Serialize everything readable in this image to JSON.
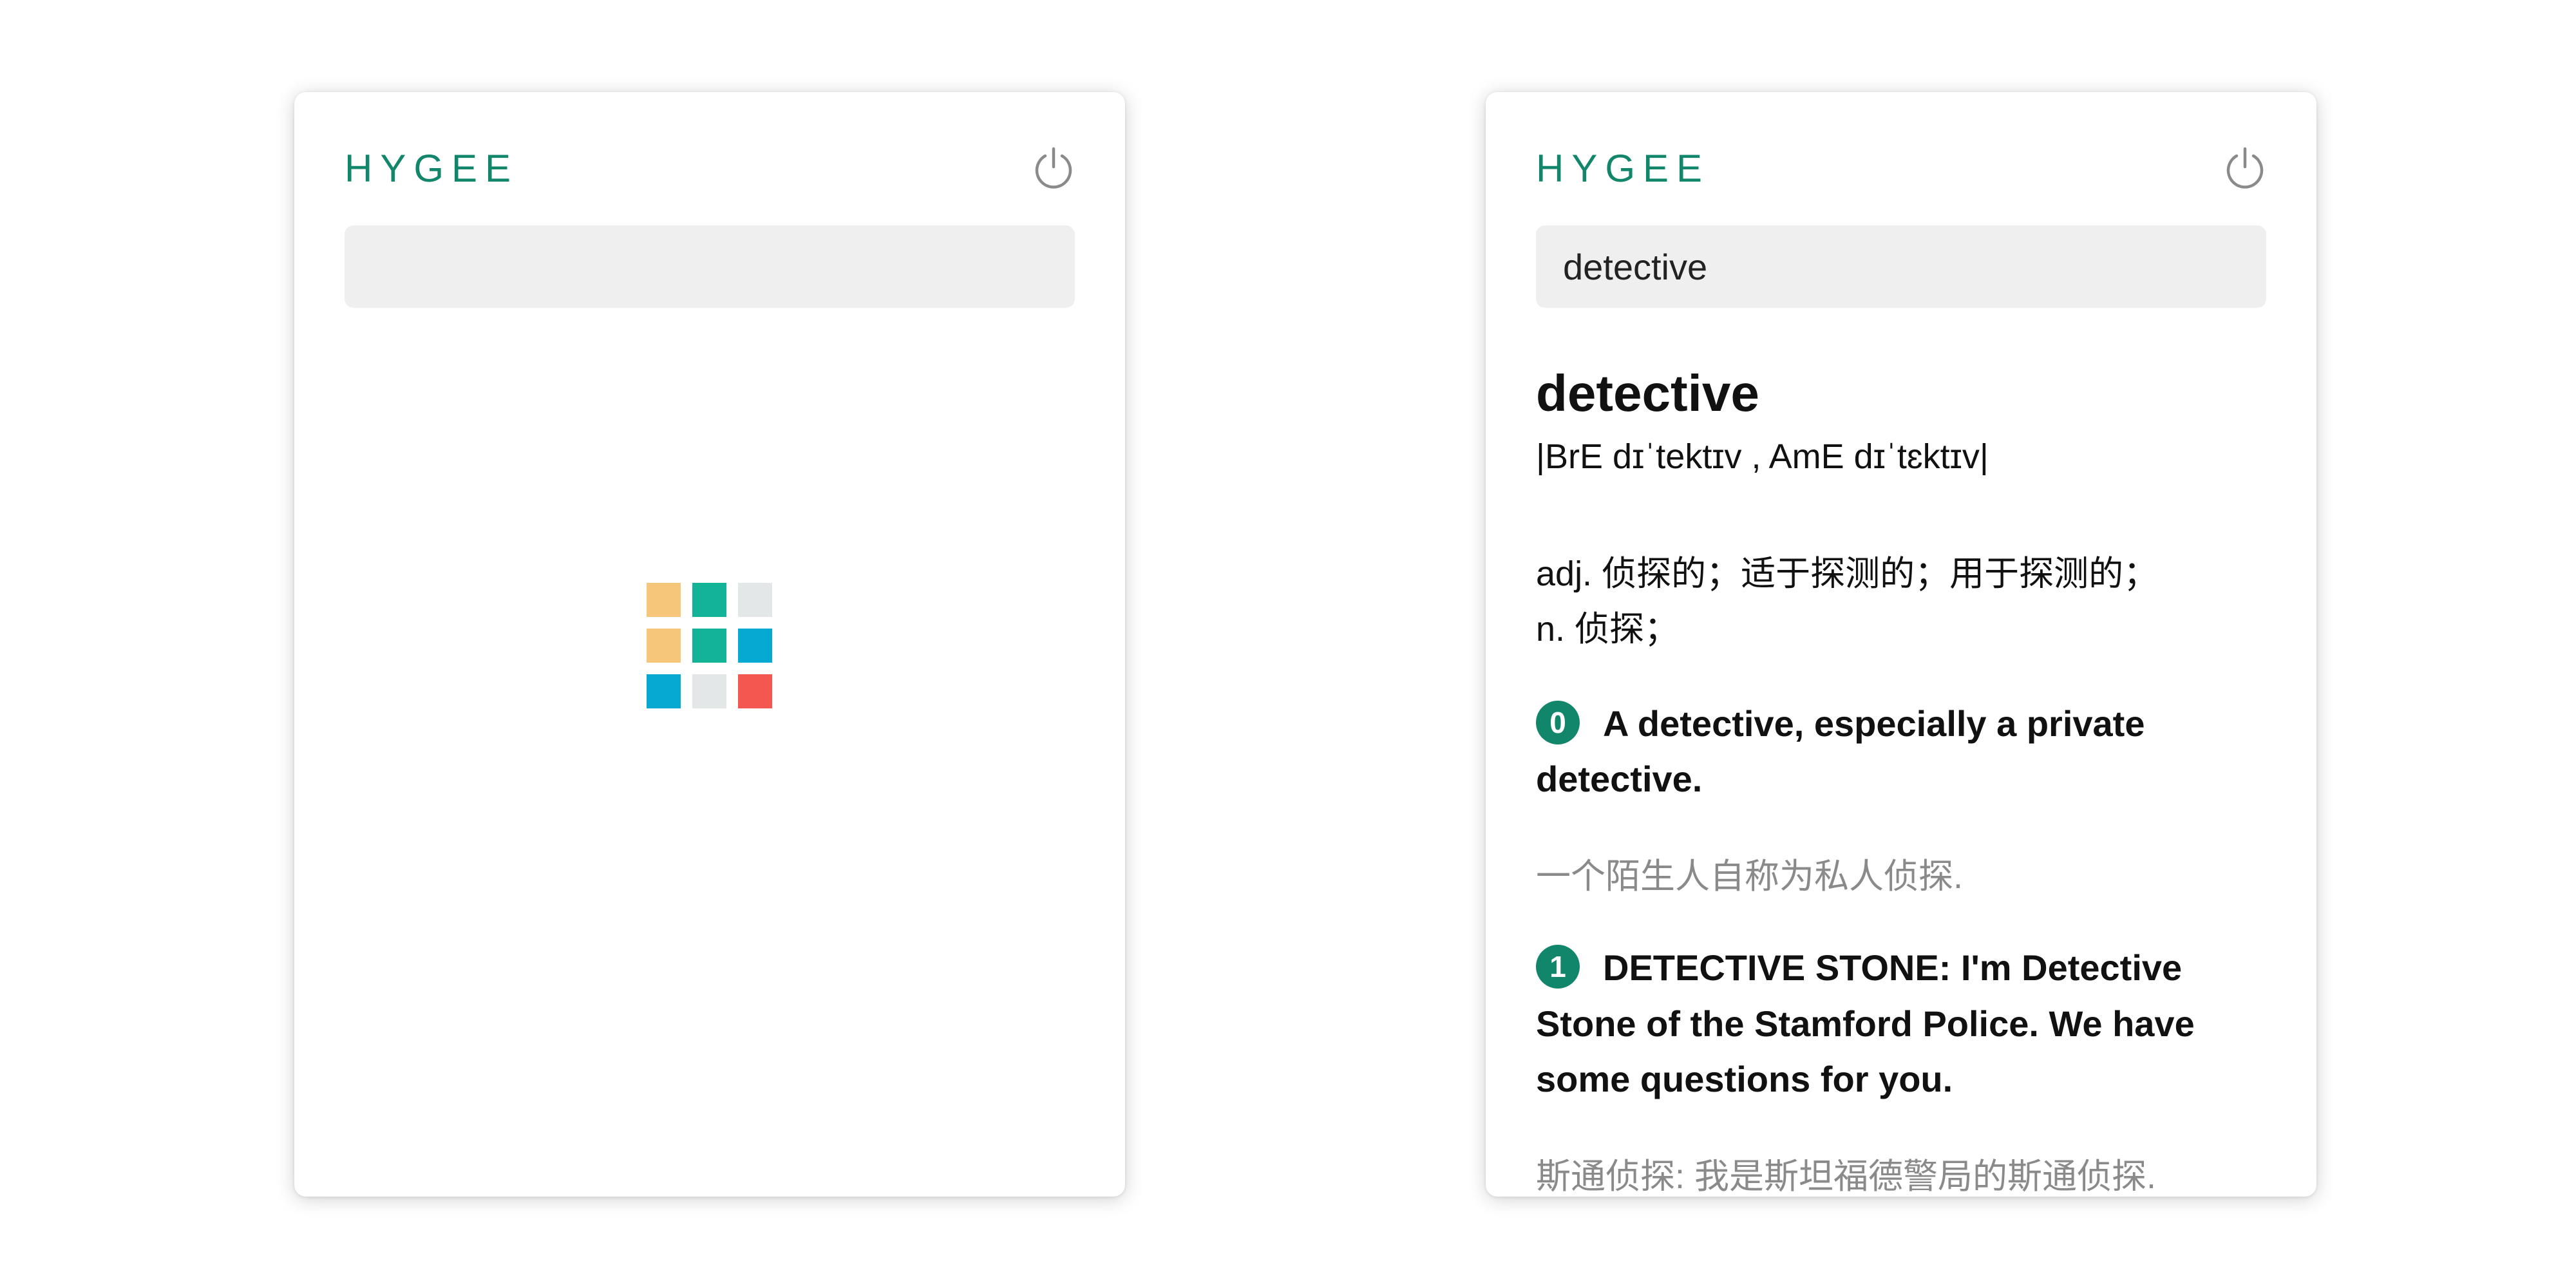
{
  "left_panel": {
    "brand": "HYGEE",
    "search": {
      "value": "",
      "placeholder": ""
    },
    "loader": {
      "colors": [
        "#f6c77a",
        "#12b396",
        "#e3e7e7",
        "#f6c77a",
        "#12b396",
        "#06a9d2",
        "#06a9d2",
        "#e3e7e7",
        "#f4574f"
      ]
    }
  },
  "right_panel": {
    "brand": "HYGEE",
    "search": {
      "value": "detective",
      "placeholder": ""
    },
    "entry": {
      "word": "detective",
      "phonetic": "|BrE dɪˈtektɪv , AmE dɪˈtɛktɪv|",
      "definitions": [
        "adj. 侦探的；适于探测的；用于探测的；",
        "n. 侦探；"
      ],
      "examples": [
        {
          "index": "0",
          "en": "A detective, especially a private detective.",
          "zh": "一个陌生人自称为私人侦探."
        },
        {
          "index": "1",
          "en": "DETECTIVE STONE: I'm Detective Stone of the Stamford Police. We have some questions for you.",
          "zh": "斯通侦探: 我是斯坦福德警局的斯通侦探."
        }
      ]
    }
  },
  "colors": {
    "brand": "#12866a",
    "icon": "#8a8a8a",
    "muted": "#8a8a8a"
  },
  "icons": {
    "power": "power-icon"
  }
}
